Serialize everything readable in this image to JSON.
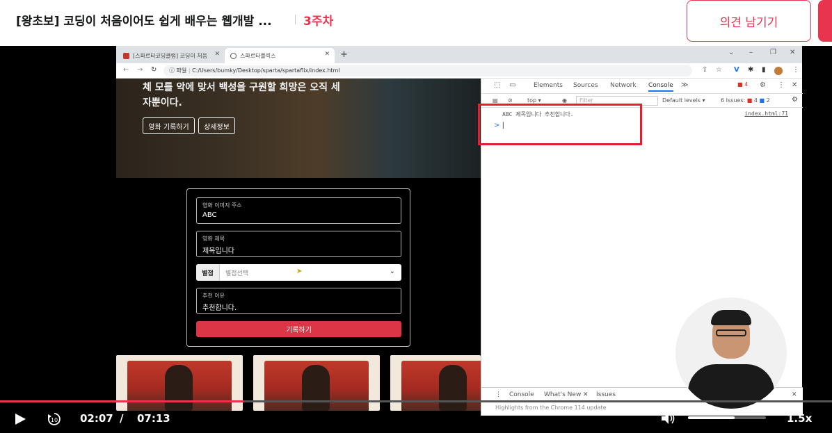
{
  "header": {
    "course_title": "[왕초보] 코딩이 처음이어도 쉽게 배우는 웹개발 ...",
    "week": "3주차",
    "feedback_label": "의견 남기기",
    "accent_color": "#e8344e"
  },
  "browser": {
    "tabs": [
      {
        "label": "[스파르타코딩클럽] 코딩이 처음",
        "icon": "sparta-favicon"
      },
      {
        "label": "스파르타플릭스",
        "icon": "globe-icon"
      }
    ],
    "url_prefix": "파일",
    "url": "C:/Users/bumky/Desktop/sparta/spartaflix/index.html"
  },
  "page": {
    "hero_text_line1": "체 모를 악에 맞서 백성을 구원할 희망은 오직 세",
    "hero_text_line2": "자뿐이다.",
    "hero_buttons": [
      "영화 기록하기",
      "상세정보"
    ],
    "form": {
      "image_label": "영화 이미지 주소",
      "image_value": "ABC",
      "title_label": "영화 제목",
      "title_value": "제목입니다",
      "rating_tag": "별점",
      "rating_placeholder": "별점선택",
      "reason_label": "추천 이유",
      "reason_value": "추천합니다.",
      "submit_label": "기록하기"
    }
  },
  "devtools": {
    "tabs": [
      "Elements",
      "Sources",
      "Network",
      "Console"
    ],
    "active_tab": "Console",
    "error_count": "4",
    "context": "top",
    "filter_placeholder": "Filter",
    "levels": "Default levels",
    "issues_label": "6 Issues:",
    "issues_errors": "4",
    "issues_info": "2",
    "console_output": "ABC 제목입니다 추천합니다.",
    "console_source": "index.html:71",
    "prompt_symbol": ">",
    "drawer_tabs": [
      "Console",
      "What's New",
      "Issues"
    ],
    "drawer_message": "Highlights from the Chrome 114 update"
  },
  "player": {
    "current_time": "02:07",
    "separator": "/",
    "duration": "07:13",
    "speed": "1.5x",
    "progress_fraction": 0.293,
    "volume_fraction": 0.6
  }
}
